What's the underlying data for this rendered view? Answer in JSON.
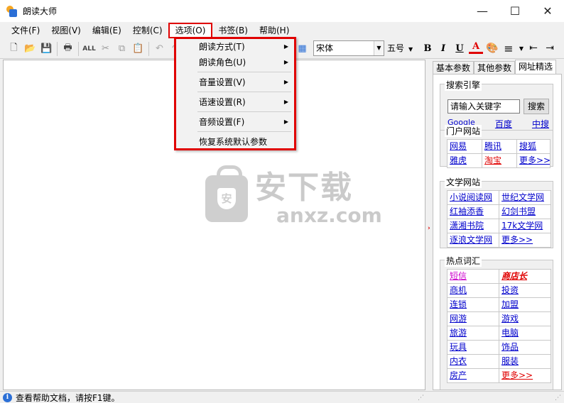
{
  "window": {
    "title": "朗读大师",
    "minimize": "—",
    "maximize": "☐",
    "close": "✕"
  },
  "menubar": {
    "items": [
      "文件(F)",
      "视图(V)",
      "编辑(E)",
      "控制(C)",
      "选项(O)",
      "书签(B)",
      "帮助(H)"
    ]
  },
  "toolbar": {
    "all_label": "ALL",
    "font": "宋体",
    "size": "五号",
    "bold": "B",
    "italic": "I",
    "underline": "U",
    "fontcolor": "A"
  },
  "options_menu": {
    "items": [
      {
        "label": "朗读方式(T)",
        "submenu": true
      },
      {
        "label": "朗读角色(U)",
        "submenu": true
      },
      {
        "label": "音量设置(V)",
        "submenu": true
      },
      {
        "label": "语速设置(R)",
        "submenu": true
      },
      {
        "label": "音频设置(F)",
        "submenu": true
      },
      {
        "label": "恢复系统默认参数",
        "submenu": false
      }
    ]
  },
  "watermark": {
    "cn": "安下载",
    "en": "anxz.com",
    "shield": "安"
  },
  "panel": {
    "tabs": [
      "基本参数",
      "其他参数",
      "网址精选"
    ],
    "search": {
      "title": "搜索引擎",
      "input_value": "请输入关键字",
      "button": "搜索",
      "engines": [
        "Google",
        "百度",
        "中搜"
      ]
    },
    "portal": {
      "title": "门户网站",
      "links": [
        "网易",
        "腾讯",
        "搜狐",
        "雅虎",
        "淘宝",
        "更多>>"
      ]
    },
    "literature": {
      "title": "文学网站",
      "links": [
        "小说阅读网",
        "世纪文学网",
        "红袖添香",
        "幻剑书盟",
        "潇湘书院",
        "17k文学网",
        "逐浪文学网",
        "更多>>"
      ]
    },
    "hot": {
      "title": "热点词汇",
      "links": [
        "短信",
        "商店长",
        "商机",
        "投资",
        "连锁",
        "加盟",
        "网游",
        "游戏",
        "旅游",
        "电脑",
        "玩具",
        "饰品",
        "内衣",
        "服装",
        "房产",
        "更多>>"
      ]
    }
  },
  "status": {
    "text": "查看帮助文档，请按F1键。",
    "info_icon": "i"
  },
  "colors": {
    "highlight": "#e00000",
    "link": "#0000cc"
  }
}
